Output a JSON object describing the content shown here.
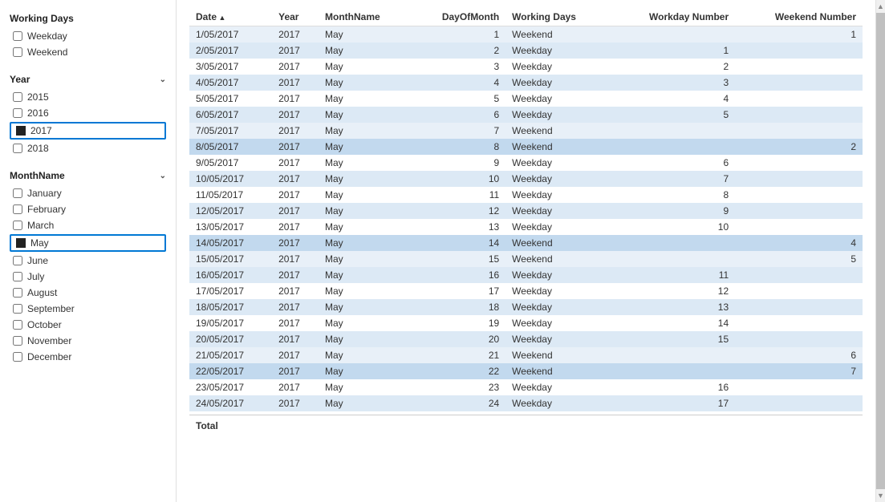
{
  "sidebar": {
    "workingDays": {
      "title": "Working Days",
      "items": [
        {
          "label": "Weekday",
          "checked": false
        },
        {
          "label": "Weekend",
          "checked": false
        }
      ]
    },
    "year": {
      "title": "Year",
      "items": [
        {
          "label": "2015",
          "checked": false
        },
        {
          "label": "2016",
          "checked": false
        },
        {
          "label": "2017",
          "checked": true,
          "selected": true
        },
        {
          "label": "2018",
          "checked": false
        }
      ]
    },
    "monthName": {
      "title": "MonthName",
      "items": [
        {
          "label": "January",
          "checked": false
        },
        {
          "label": "February",
          "checked": false
        },
        {
          "label": "March",
          "checked": false
        },
        {
          "label": "May",
          "checked": true,
          "selected": true
        },
        {
          "label": "June",
          "checked": false
        },
        {
          "label": "July",
          "checked": false
        },
        {
          "label": "August",
          "checked": false
        },
        {
          "label": "September",
          "checked": false
        },
        {
          "label": "October",
          "checked": false
        },
        {
          "label": "November",
          "checked": false
        },
        {
          "label": "December",
          "checked": false
        }
      ]
    }
  },
  "table": {
    "columns": [
      {
        "label": "Date",
        "sort": "asc"
      },
      {
        "label": "Year"
      },
      {
        "label": "MonthName"
      },
      {
        "label": "DayOfMonth",
        "align": "right"
      },
      {
        "label": "Working Days"
      },
      {
        "label": "Workday Number",
        "align": "right"
      },
      {
        "label": "Weekend Number",
        "align": "right"
      }
    ],
    "rows": [
      {
        "date": "1/05/2017",
        "year": "2017",
        "month": "May",
        "day": 1,
        "workingDay": "Weekend",
        "workdayNum": "",
        "weekendNum": 1,
        "highlight": false
      },
      {
        "date": "2/05/2017",
        "year": "2017",
        "month": "May",
        "day": 2,
        "workingDay": "Weekday",
        "workdayNum": 1,
        "weekendNum": "",
        "highlight": true
      },
      {
        "date": "3/05/2017",
        "year": "2017",
        "month": "May",
        "day": 3,
        "workingDay": "Weekday",
        "workdayNum": 2,
        "weekendNum": "",
        "highlight": false
      },
      {
        "date": "4/05/2017",
        "year": "2017",
        "month": "May",
        "day": 4,
        "workingDay": "Weekday",
        "workdayNum": 3,
        "weekendNum": "",
        "highlight": true
      },
      {
        "date": "5/05/2017",
        "year": "2017",
        "month": "May",
        "day": 5,
        "workingDay": "Weekday",
        "workdayNum": 4,
        "weekendNum": "",
        "highlight": false
      },
      {
        "date": "6/05/2017",
        "year": "2017",
        "month": "May",
        "day": 6,
        "workingDay": "Weekday",
        "workdayNum": 5,
        "weekendNum": "",
        "highlight": true
      },
      {
        "date": "7/05/2017",
        "year": "2017",
        "month": "May",
        "day": 7,
        "workingDay": "Weekend",
        "workdayNum": "",
        "weekendNum": "",
        "highlight": false
      },
      {
        "date": "8/05/2017",
        "year": "2017",
        "month": "May",
        "day": 8,
        "workingDay": "Weekend",
        "workdayNum": "",
        "weekendNum": 2,
        "highlight": true
      },
      {
        "date": "9/05/2017",
        "year": "2017",
        "month": "May",
        "day": 9,
        "workingDay": "Weekday",
        "workdayNum": 6,
        "weekendNum": "",
        "highlight": false
      },
      {
        "date": "10/05/2017",
        "year": "2017",
        "month": "May",
        "day": 10,
        "workingDay": "Weekday",
        "workdayNum": 7,
        "weekendNum": "",
        "highlight": true
      },
      {
        "date": "11/05/2017",
        "year": "2017",
        "month": "May",
        "day": 11,
        "workingDay": "Weekday",
        "workdayNum": 8,
        "weekendNum": "",
        "highlight": false
      },
      {
        "date": "12/05/2017",
        "year": "2017",
        "month": "May",
        "day": 12,
        "workingDay": "Weekday",
        "workdayNum": 9,
        "weekendNum": "",
        "highlight": true
      },
      {
        "date": "13/05/2017",
        "year": "2017",
        "month": "May",
        "day": 13,
        "workingDay": "Weekday",
        "workdayNum": 10,
        "weekendNum": "",
        "highlight": false
      },
      {
        "date": "14/05/2017",
        "year": "2017",
        "month": "May",
        "day": 14,
        "workingDay": "Weekend",
        "workdayNum": "",
        "weekendNum": 4,
        "highlight": true
      },
      {
        "date": "15/05/2017",
        "year": "2017",
        "month": "May",
        "day": 15,
        "workingDay": "Weekend",
        "workdayNum": "",
        "weekendNum": 5,
        "highlight": false
      },
      {
        "date": "16/05/2017",
        "year": "2017",
        "month": "May",
        "day": 16,
        "workingDay": "Weekday",
        "workdayNum": 11,
        "weekendNum": "",
        "highlight": true
      },
      {
        "date": "17/05/2017",
        "year": "2017",
        "month": "May",
        "day": 17,
        "workingDay": "Weekday",
        "workdayNum": 12,
        "weekendNum": "",
        "highlight": false
      },
      {
        "date": "18/05/2017",
        "year": "2017",
        "month": "May",
        "day": 18,
        "workingDay": "Weekday",
        "workdayNum": 13,
        "weekendNum": "",
        "highlight": true
      },
      {
        "date": "19/05/2017",
        "year": "2017",
        "month": "May",
        "day": 19,
        "workingDay": "Weekday",
        "workdayNum": 14,
        "weekendNum": "",
        "highlight": false
      },
      {
        "date": "20/05/2017",
        "year": "2017",
        "month": "May",
        "day": 20,
        "workingDay": "Weekday",
        "workdayNum": 15,
        "weekendNum": "",
        "highlight": true
      },
      {
        "date": "21/05/2017",
        "year": "2017",
        "month": "May",
        "day": 21,
        "workingDay": "Weekend",
        "workdayNum": "",
        "weekendNum": 6,
        "highlight": false
      },
      {
        "date": "22/05/2017",
        "year": "2017",
        "month": "May",
        "day": 22,
        "workingDay": "Weekend",
        "workdayNum": "",
        "weekendNum": 7,
        "highlight": true
      },
      {
        "date": "23/05/2017",
        "year": "2017",
        "month": "May",
        "day": 23,
        "workingDay": "Weekday",
        "workdayNum": 16,
        "weekendNum": "",
        "highlight": false
      },
      {
        "date": "24/05/2017",
        "year": "2017",
        "month": "May",
        "day": 24,
        "workingDay": "Weekday",
        "workdayNum": 17,
        "weekendNum": "",
        "highlight": true
      }
    ],
    "totalLabel": "Total"
  }
}
